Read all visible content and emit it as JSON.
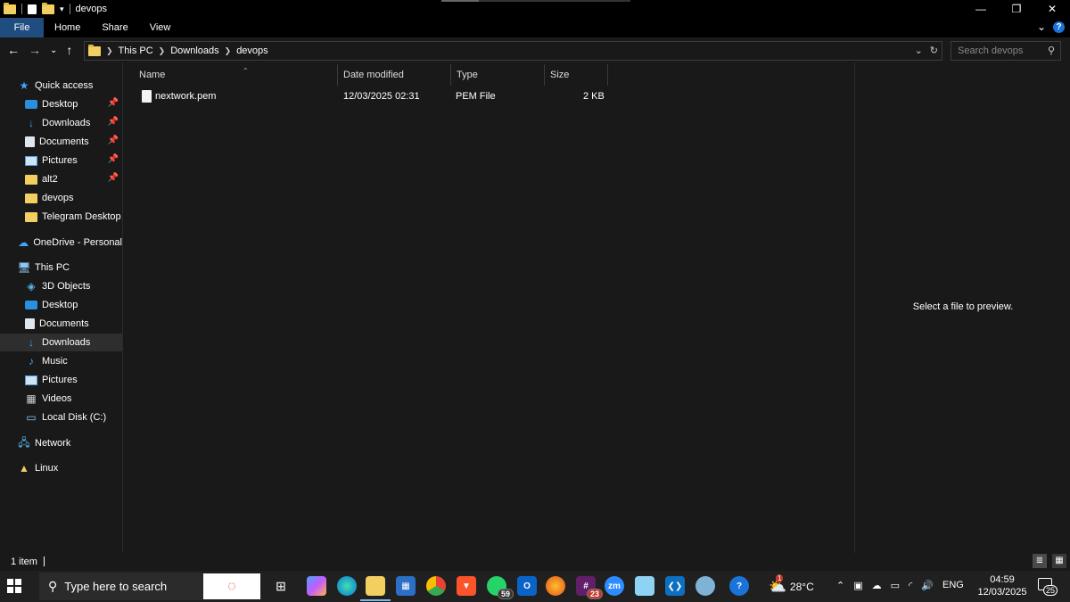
{
  "window": {
    "title": "devops",
    "minimize": "—",
    "restore": "❐",
    "close": "✕"
  },
  "ribbon": {
    "tabs": [
      "File",
      "Home",
      "Share",
      "View"
    ],
    "expand": "⌄",
    "help": "?"
  },
  "address": {
    "crumbs": [
      "This PC",
      "Downloads",
      "devops"
    ],
    "dropdown": "⌄",
    "refresh": "↻",
    "search_placeholder": "Search devops",
    "search_icon": "⚲"
  },
  "nav": {
    "back": "←",
    "forward": "→",
    "recent": "⌄",
    "up": "↑"
  },
  "sidebar": {
    "quick_access": "Quick access",
    "items": [
      {
        "label": "Desktop",
        "icon": "desktop-icon",
        "pinned": true
      },
      {
        "label": "Downloads",
        "icon": "downloads-icon",
        "pinned": true
      },
      {
        "label": "Documents",
        "icon": "documents-icon",
        "pinned": true
      },
      {
        "label": "Pictures",
        "icon": "pictures-icon",
        "pinned": true
      },
      {
        "label": "alt2",
        "icon": "folder-icon",
        "pinned": true
      },
      {
        "label": "devops",
        "icon": "folder-icon",
        "pinned": false
      },
      {
        "label": "Telegram Desktop",
        "icon": "folder-icon",
        "pinned": false
      }
    ],
    "onedrive": "OneDrive - Personal",
    "this_pc": "This PC",
    "pc_items": [
      {
        "label": "3D Objects",
        "icon": "3d-objects-icon"
      },
      {
        "label": "Desktop",
        "icon": "desktop-icon"
      },
      {
        "label": "Documents",
        "icon": "documents-icon"
      },
      {
        "label": "Downloads",
        "icon": "downloads-icon",
        "selected": true
      },
      {
        "label": "Music",
        "icon": "music-icon"
      },
      {
        "label": "Pictures",
        "icon": "pictures-icon"
      },
      {
        "label": "Videos",
        "icon": "videos-icon"
      },
      {
        "label": "Local Disk (C:)",
        "icon": "local-disk-icon"
      }
    ],
    "network": "Network",
    "linux": "Linux"
  },
  "table": {
    "columns": {
      "name": "Name",
      "date": "Date modified",
      "type": "Type",
      "size": "Size"
    },
    "rows": [
      {
        "name": "nextwork.pem",
        "date": "12/03/2025 02:31",
        "type": "PEM File",
        "size": "2 KB"
      }
    ]
  },
  "preview": {
    "message": "Select a file to preview."
  },
  "status": {
    "count": "1 item"
  },
  "taskbar": {
    "search_text": "Type here to search",
    "weather": "28°C",
    "weather_badge": "1",
    "lang": "ENG",
    "time": "04:59",
    "date": "12/03/2025",
    "whatsapp_badge": "59",
    "slack_badge": "23",
    "zoom_label": "zm",
    "notifications": "25"
  },
  "colors": {
    "accent": "#1f4d80",
    "background": "#191919",
    "taskbar": "#202020"
  }
}
